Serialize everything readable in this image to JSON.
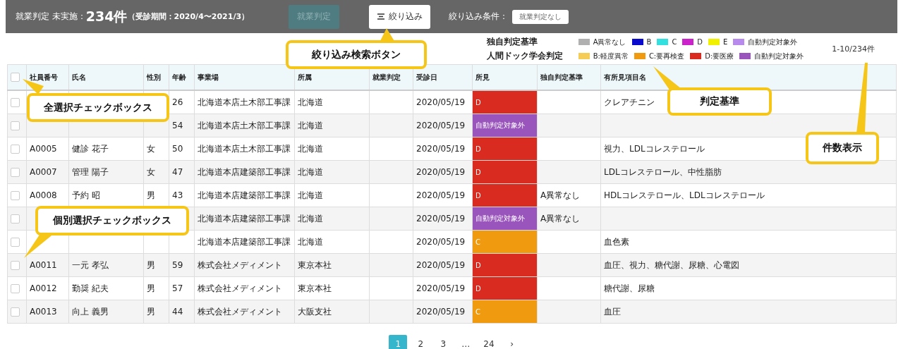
{
  "header": {
    "status_label": "就業判定 未実施：",
    "count": "234件",
    "period": "（受診期間：2020/4〜2021/3）",
    "judge_button": {
      "label": "就業判定",
      "disabled": true
    },
    "filter_button": {
      "label": "絞り込み"
    },
    "filter_condition_label": "絞り込み条件：",
    "filter_condition_chip": "就業判定なし"
  },
  "legend": [
    {
      "title": "独自判定基準",
      "items": [
        {
          "label": "A異常なし",
          "color": "#b0b0b0"
        },
        {
          "label": "B",
          "color": "#0a0acc"
        },
        {
          "label": "C",
          "color": "#33e0e0"
        },
        {
          "label": "D",
          "color": "#cc22cc"
        },
        {
          "label": "E",
          "color": "#f0f000"
        },
        {
          "label": "自動判定対象外",
          "color": "#b98aee"
        }
      ]
    },
    {
      "title": "人間ドック学会判定",
      "items": [
        {
          "label": "B:軽度異常",
          "color": "#f5cc55"
        },
        {
          "label": "C:要再検査",
          "color": "#f09a0f"
        },
        {
          "label": "D:要医療",
          "color": "#d92b1f"
        },
        {
          "label": "自動判定対象外",
          "color": "#9955bb"
        }
      ]
    }
  ],
  "record_count": "1-10/234件",
  "table": {
    "select_all": {
      "checked": false
    },
    "columns": [
      "社員番号",
      "氏名",
      "性別",
      "年齢",
      "事業場",
      "所属",
      "就業判定",
      "受診日",
      "所見",
      "独自判定基準",
      "有所見項目名"
    ],
    "rows": [
      {
        "checked": false,
        "age": "26",
        "site": "北海道本店土木部工事課",
        "dept": "北海道",
        "date": "2020/05/19",
        "finding": {
          "label": "D",
          "color": "#d92b1f"
        },
        "items": "クレアチニン"
      },
      {
        "checked": false,
        "age": "54",
        "site": "北海道本店土木部工事課",
        "dept": "北海道",
        "date": "2020/05/19",
        "finding": {
          "label": "自動判定対象外",
          "color": "#9955bb"
        }
      },
      {
        "checked": false,
        "id": "A0005",
        "name": "健診 花子",
        "sex": "女",
        "age": "50",
        "site": "北海道本店土木部工事課",
        "dept": "北海道",
        "date": "2020/05/19",
        "finding": {
          "label": "D",
          "color": "#d92b1f"
        },
        "items": "視力、LDLコレステロール"
      },
      {
        "checked": false,
        "id": "A0007",
        "name": "管理 陽子",
        "sex": "女",
        "age": "47",
        "site": "北海道本店建築部工事課",
        "dept": "北海道",
        "date": "2020/05/19",
        "finding": {
          "label": "D",
          "color": "#d92b1f"
        },
        "items": "LDLコレステロール、中性脂肪"
      },
      {
        "checked": false,
        "id": "A0008",
        "name": "予約 昭",
        "sex": "男",
        "age": "43",
        "site": "北海道本店建築部工事課",
        "dept": "北海道",
        "date": "2020/05/19",
        "finding": {
          "label": "D",
          "color": "#d92b1f"
        },
        "own": "A異常なし",
        "items": "HDLコレステロール、LDLコレステロール"
      },
      {
        "checked": false,
        "site": "北海道本店建築部工事課",
        "dept": "北海道",
        "date": "2020/05/19",
        "finding": {
          "label": "自動判定対象外",
          "color": "#9955bb"
        },
        "own": "A異常なし"
      },
      {
        "checked": false,
        "site": "北海道本店建築部工事課",
        "dept": "北海道",
        "date": "2020/05/19",
        "finding": {
          "label": "C",
          "color": "#f09a0f"
        },
        "items": "血色素"
      },
      {
        "checked": false,
        "id": "A0011",
        "name": "一元 孝弘",
        "sex": "男",
        "age": "59",
        "site": "株式会社メディメント",
        "dept": "東京本社",
        "date": "2020/05/19",
        "finding": {
          "label": "D",
          "color": "#d92b1f"
        },
        "items": "血圧、視力、糖代謝、尿糖、心電図"
      },
      {
        "checked": false,
        "id": "A0012",
        "name": "勤奨 紀夫",
        "sex": "男",
        "age": "57",
        "site": "株式会社メディメント",
        "dept": "東京本社",
        "date": "2020/05/19",
        "finding": {
          "label": "D",
          "color": "#d92b1f"
        },
        "items": "糖代謝、尿糖"
      },
      {
        "checked": false,
        "id": "A0013",
        "name": "向上 義男",
        "sex": "男",
        "age": "44",
        "site": "株式会社メディメント",
        "dept": "大阪支社",
        "date": "2020/05/19",
        "finding": {
          "label": "C",
          "color": "#f09a0f"
        },
        "items": "血圧"
      }
    ]
  },
  "pagination": [
    {
      "label": "1",
      "selected": true
    },
    {
      "label": "2",
      "selected": false
    },
    {
      "label": "3",
      "selected": false
    },
    {
      "label": "…",
      "selected": false
    },
    {
      "label": "24",
      "selected": false
    },
    {
      "label": "›",
      "selected": false
    }
  ],
  "callouts": [
    {
      "kind": "filter",
      "text": "絞り込み検索ボタン"
    },
    {
      "kind": "select_all",
      "text": "全選択チェックボックス"
    },
    {
      "kind": "criteria",
      "text": "判定基準"
    },
    {
      "kind": "count",
      "text": "件数表示"
    },
    {
      "kind": "row_select",
      "text": "個別選択チェックボックス"
    }
  ]
}
